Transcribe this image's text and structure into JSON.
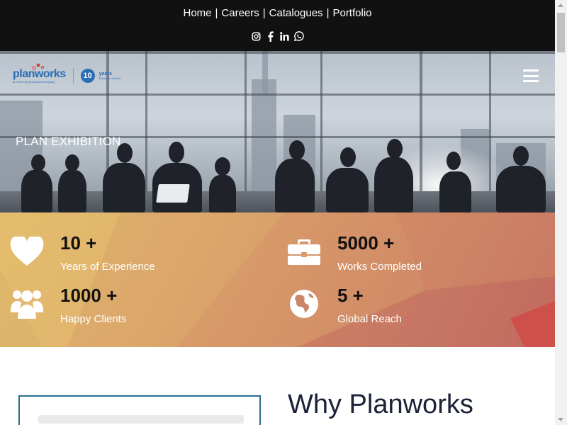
{
  "nav": {
    "links": [
      "Home",
      "Careers",
      "Catalogues",
      "Portfolio"
    ],
    "separator": "|"
  },
  "social": [
    "instagram-icon",
    "facebook-icon",
    "linkedin-icon",
    "whatsapp-icon"
  ],
  "logo": {
    "word_plan": "plan",
    "word_works": "works",
    "tagline": "an event-led production company",
    "badge_number": "10",
    "badge_text": "years",
    "badge_subtext": "Exhibition Events"
  },
  "hero": {
    "title": "PLAN EXHIBITION"
  },
  "stats": [
    {
      "icon": "heart-icon",
      "number": "10 +",
      "label": "Years of Experience"
    },
    {
      "icon": "briefcase-icon",
      "number": "5000 +",
      "label": "Works Completed"
    },
    {
      "icon": "users-icon",
      "number": "1000 +",
      "label": "Happy Clients"
    },
    {
      "icon": "globe-icon",
      "number": "5 +",
      "label": "Global Reach"
    }
  ],
  "why": {
    "title": "Why Planworks"
  },
  "colors": {
    "topbar": "#111111",
    "accent_blue": "#2a6db5",
    "stats_gradient_start": "#e0b86a",
    "stats_gradient_end": "#c0665f",
    "heading": "#1b2238"
  }
}
